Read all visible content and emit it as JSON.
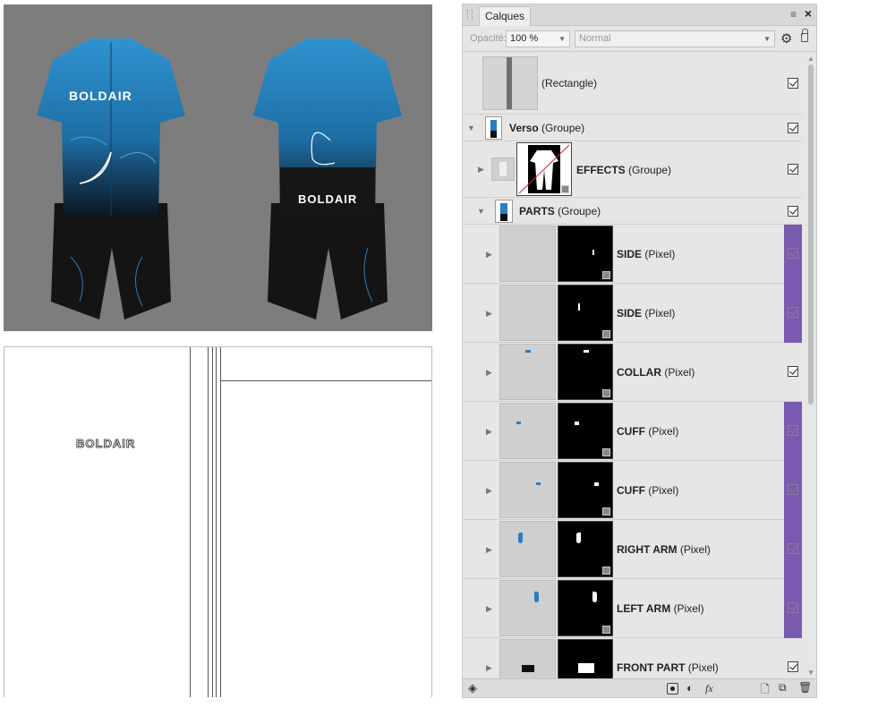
{
  "preview": {
    "brand": "BOLDAIR"
  },
  "pattern": {
    "logo": "BOLDAIR"
  },
  "panel": {
    "tab_label": "Calques",
    "menu_icon": "menu-icon",
    "close_label": "×",
    "opacity_label": "Opacité:",
    "opacity_value": "100 %",
    "blend_mode": "Normal",
    "layers": [
      {
        "name": "",
        "type": "(Rectangle)",
        "checked": true
      },
      {
        "name": "Verso",
        "type": "(Groupe)",
        "checked": true
      },
      {
        "name": "EFFECTS",
        "type": "(Groupe)",
        "checked": true
      },
      {
        "name": "PARTS",
        "type": "(Groupe)",
        "checked": true
      },
      {
        "name": "SIDE",
        "type": "(Pixel)",
        "checked": true,
        "highlight": true
      },
      {
        "name": "SIDE",
        "type": "(Pixel)",
        "checked": true,
        "highlight": true
      },
      {
        "name": "COLLAR",
        "type": "(Pixel)",
        "checked": true
      },
      {
        "name": "CUFF",
        "type": "(Pixel)",
        "checked": true,
        "highlight": true
      },
      {
        "name": "CUFF",
        "type": "(Pixel)",
        "checked": true,
        "highlight": true
      },
      {
        "name": "RIGHT ARM",
        "type": "(Pixel)",
        "checked": true,
        "highlight": true
      },
      {
        "name": "LEFT ARM",
        "type": "(Pixel)",
        "checked": true,
        "highlight": true
      },
      {
        "name": "FRONT PART",
        "type": "(Pixel)",
        "checked": true
      }
    ],
    "bottom_fx": "fx",
    "highlight_color": "#7a5aae",
    "jersey_color": "#2a8ac8"
  }
}
